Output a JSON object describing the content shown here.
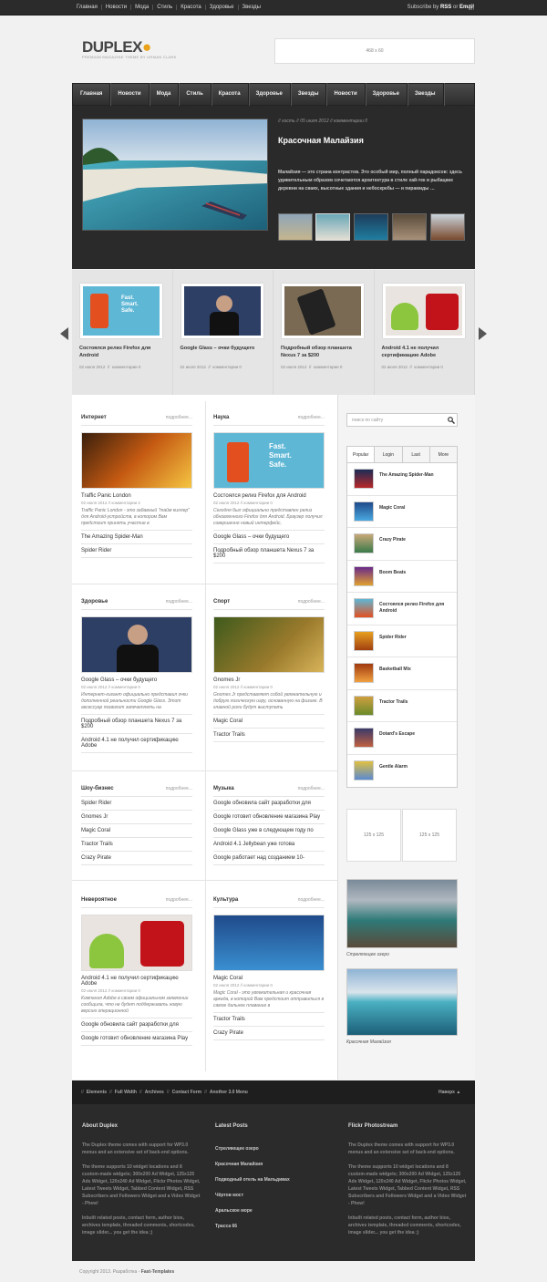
{
  "topnav": [
    "Главная",
    "Новости",
    "Мода",
    "Стиль",
    "Красота",
    "Здоровье",
    "Звезды"
  ],
  "subscribe": {
    "pre": "Subscribe by ",
    "rss": "RSS",
    "or": " or ",
    "email": "Email"
  },
  "logo": {
    "name": "DUPLEX",
    "tagline": "PREMIUM MAGAZINE THEME BY URMAN CLARK"
  },
  "banner": "468 x 60",
  "mainnav": [
    "Главная",
    "Новости",
    "Мода",
    "Стиль",
    "Красота",
    "Здоровье",
    "Звезды",
    "Новости",
    "Здоровье",
    "Звезды"
  ],
  "featured": {
    "meta": "// гость // 05 июля 2012 // комментарии 0",
    "title": "Красочная Малайзия",
    "desc": "Малайзия — это страна контрастов. Это особый мир, полный парадоксов: здесь удивительным образом сочетаются архитектура в стиле хай-тек и рыбацкие деревни на сваях, высотные здания и небоскребы — и пирамиды …"
  },
  "carousel": [
    {
      "title": "Состоялся релиз Firefox для Android",
      "date": "02 июля 2012",
      "comments": "комментарии 0"
    },
    {
      "title": "Google Glass – очки будущего",
      "date": "02 июля 2012",
      "comments": "комментарии 0"
    },
    {
      "title": "Подробный обзор планшета Nexus 7 за $200",
      "date": "02 июля 2012",
      "comments": "комментарии 0"
    },
    {
      "title": "Android 4.1 не получил сертификацию Adobe",
      "date": "02 июля 2012",
      "comments": "комментарии 0"
    }
  ],
  "more": "подробнее...",
  "sections": {
    "internet": {
      "title": "Интернет",
      "item": "Traffic Panic London",
      "date": "02 июля 2012",
      "comments": "комментарии 2",
      "excerpt": "Traffic Panic London - это забавный \"тайм киллер\" для Android-устройств, в котором Вам предстоит принять участие в",
      "links": [
        "The Amazing Spider-Man",
        "Spider Rider"
      ]
    },
    "science": {
      "title": "Наука",
      "item": "Состоялся релиз Firefox для Android",
      "date": "02 июля 2012",
      "comments": "комментарии 0",
      "excerpt": "Сегодня был официально представлен релиз обновленного Firefox для Android. Браузер получил совершенно новый интерфейс,",
      "links": [
        "Google Glass – очки будущего",
        "Подробный обзор планшета Nexus 7 за $200"
      ]
    },
    "health": {
      "title": "Здоровье",
      "item": "Google Glass – очки будущего",
      "date": "02 июля 2012",
      "comments": "комментарии 0",
      "excerpt": "Интернет-гигант официально представил очки дополненной реальности Google Glass. Этот аксессуар позволит запечатлеть на",
      "links": [
        "Подробный обзор планшета Nexus 7 за $200",
        "Android 4.1 не получил сертификацию Adobe"
      ]
    },
    "sport": {
      "title": "Спорт",
      "item": "Gnomes Jr",
      "date": "02 июля 2012",
      "comments": "комментарии 0",
      "excerpt": "Gnomes Jr представляет собой увлекательную и добрую логическую игру, основанную на физике. В главной роли будут выступать",
      "links": [
        "Magic Coral",
        "Tractor Trails"
      ]
    },
    "showbiz": {
      "title": "Шоу-бизнес",
      "links": [
        "Spider Rider",
        "Gnomes Jr",
        "Magic Coral",
        "Tractor Trails",
        "Crazy Pirate"
      ]
    },
    "music": {
      "title": "Музыка",
      "links": [
        "Google обновила сайт разработки для",
        "Google готовит обновление магазина Play",
        "Google Glass уже в следующем году по",
        "Android 4.1 Jellybean уже готова",
        "Google работает над созданием 10-"
      ]
    },
    "unbelievable": {
      "title": "Невероятное",
      "item": "Android 4.1 не получил сертификацию Adobe",
      "date": "02 июля 2012",
      "comments": "комментарии 0",
      "excerpt": "Компания Adobe в своем официальном заявлении сообщила, что не будет поддерживать новую версию операционной",
      "links": [
        "Google обновила сайт разработки для",
        "Google готовит обновление магазина Play"
      ]
    },
    "culture": {
      "title": "Культура",
      "item": "Magic Coral",
      "date": "02 июля 2012",
      "comments": "комментарии 0",
      "excerpt": "Magic Coral - это увлекательная и красочная аркада, в которой Вам предстоит отправиться в самое дальнее плавание в",
      "links": [
        "Tractor Trails",
        "Crazy Pirate"
      ]
    }
  },
  "search": {
    "placeholder": "поиск по сайту"
  },
  "tabs": [
    "Popular",
    "Login",
    "Last",
    "More"
  ],
  "popular": [
    "The Amazing Spider-Man",
    "Magic Coral",
    "Crazy Pirate",
    "Boom Beats",
    "Состоялся релиз Firefox для Android",
    "Spider Rider",
    "Basketball Mix",
    "Tractor Trails",
    "Dotard's Escape",
    "Gentle Alarm"
  ],
  "ads125": [
    "125 x 125",
    "125 x 125"
  ],
  "photos": [
    "Стреляющее озеро",
    "Красочная Малайзия"
  ],
  "footnav": [
    "//",
    "Elements",
    "//",
    "Full Width",
    "//",
    "Archives",
    "//",
    "Contact Form",
    "//",
    "Another 3.0 Menu"
  ],
  "footup": "Наверх",
  "footer": {
    "about": {
      "title": "About Duplex",
      "p1": "The Duplex theme comes with support for WP3.0 menus and an extensive set of back-end options.",
      "p2": "The theme supports 10 widget locations and 8 custom-made widgets; 300x200 Ad Widget, 125x125 Ads Widget, 120x240 Ad Widget, Flickr Photos Widget, Latest Tweets Widget, Tabbed Content Widget, RSS Subscribers and Followers Widget and a Video Widget - Phew!",
      "p3": "Inbuilt related posts, contact form, author bios, archives template, threaded comments, shortcodes, image slider... you get the idea ;)"
    },
    "latest": {
      "title": "Latest Posts",
      "items": [
        "Стреляющее озеро",
        "Красочная Малайзия",
        "Подводный отель на Мальдивах",
        "Чёртов мост",
        "Аральское море",
        "Трасса 66"
      ]
    },
    "flickr": {
      "title": "Flickr Photostream",
      "p1": "The Duplex theme comes with support for WP3.0 menus and an extensive set of back-end options.",
      "p2": "The theme supports 10 widget locations and 8 custom-made widgets; 300x200 Ad Widget, 125x125 Ads Widget, 120x240 Ad Widget, Flickr Photos Widget, Latest Tweets Widget, Tabbed Content Widget, RSS Subscribers and Followers Widget and a Video Widget - Phew!",
      "p3": "Inbuilt related posts, contact form, author bios, archives template, threaded comments, shortcodes, image slider... you get the idea ;)"
    }
  },
  "copyright": {
    "text": "Copyright 2013. Разработка - ",
    "brand": "Fast-Templates"
  },
  "colors": {
    "accent": "#e9a21a",
    "dark": "#2b2b2b",
    "footer": "#1e1e1e"
  }
}
